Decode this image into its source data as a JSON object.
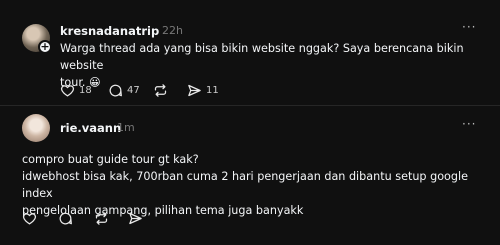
{
  "post1": {
    "username": "kresnadanatrip",
    "time": "22h",
    "more": "···",
    "text_line1": "Warga thread ada yang bisa bikin website nggak? Saya berencana bikin website",
    "text_line2": "tour. 😀",
    "like_count": "18",
    "reply_count": "47",
    "share_count": "11"
  },
  "post2": {
    "username": "rie.vaann",
    "time": "1m",
    "more": "···",
    "line1": "compro buat guide tour gt kak?",
    "line2": "idwebhost bisa kak, 700rban cuma 2 hari pengerjaan dan dibantu setup google index",
    "line3": "pengelolaan gampang, pilihan tema juga banyakk"
  },
  "icons": {
    "like": "heart-icon",
    "reply": "comment-icon",
    "repost": "repost-icon",
    "share": "send-icon",
    "follow": "plus-icon"
  }
}
